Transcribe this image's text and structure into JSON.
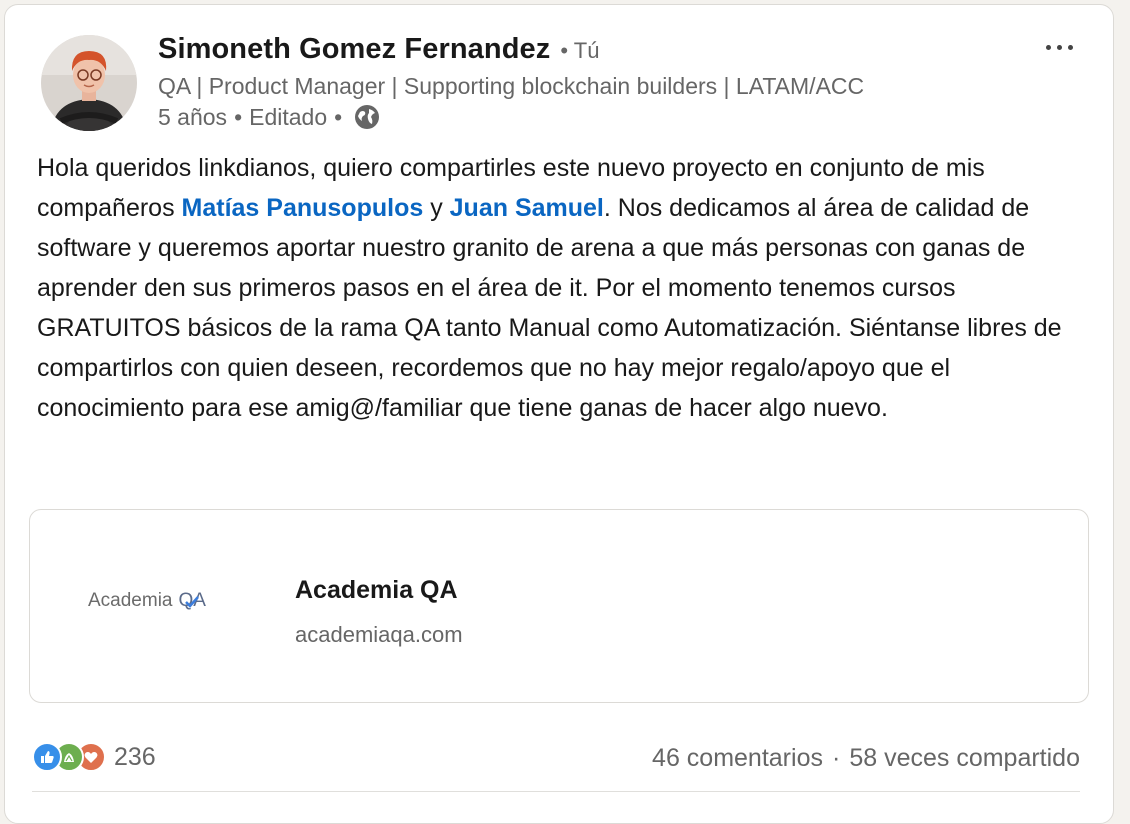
{
  "author": {
    "name": "Simoneth Gomez Fernandez",
    "degree": "• Tú",
    "headline": "QA | Product Manager | Supporting blockchain builders | LATAM/ACC",
    "time": "5 años",
    "edited": "Editado",
    "visibility_icon": "globe-icon"
  },
  "post": {
    "text_1": "Hola queridos linkdianos, quiero compartirles este nuevo proyecto en conjunto de mis compañeros ",
    "mention_1": "Matías Panusopulos",
    "text_2": " y ",
    "mention_2": "Juan Samuel",
    "text_3": ". Nos dedicamos al área de calidad de software y queremos aportar nuestro granito de arena a que más personas con ganas de aprender den sus primeros pasos en el área de it. Por el momento tenemos cursos GRATUITOS básicos de la rama QA tanto Manual como Automatización. Siéntanse libres de compartirlos con quien deseen, recordemos que no hay mejor regalo/apoyo que el conocimiento para ese amig@/familiar que tiene ganas de hacer algo nuevo."
  },
  "link_preview": {
    "logo_text": "Academia",
    "logo_qa": "QA",
    "title": "Academia QA",
    "domain": "academiaqa.com"
  },
  "social": {
    "reactions": [
      "like-icon",
      "support-icon",
      "love-icon"
    ],
    "reaction_count": "236",
    "comments": "46 comentarios",
    "separator": "·",
    "shares": "58 veces compartido"
  },
  "colors": {
    "mention": "#0a66c2",
    "like": "#378fe9",
    "support": "#6dae4f",
    "love": "#df704d"
  }
}
